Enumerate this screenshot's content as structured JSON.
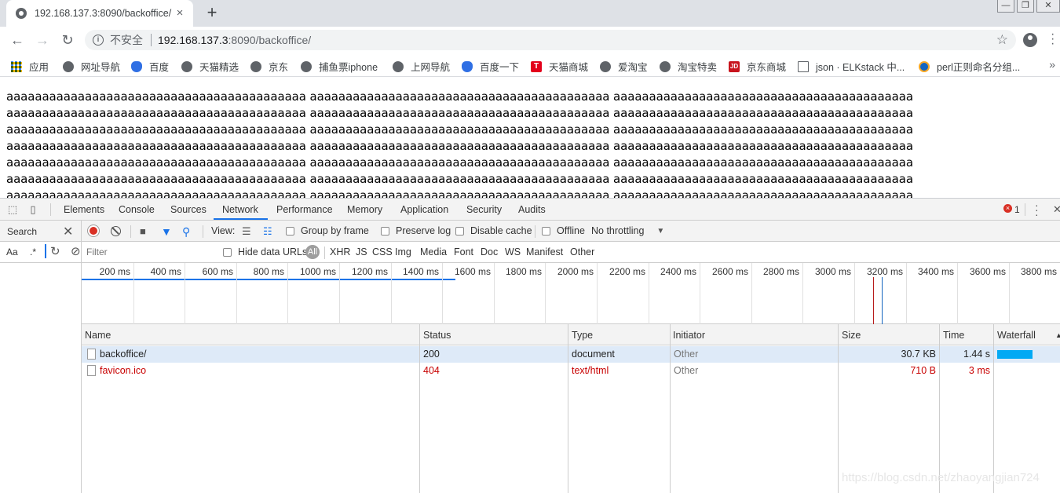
{
  "browser": {
    "tab_title": "192.168.137.3:8090/backoffice/",
    "tab_close": "×",
    "new_tab": "+",
    "window_controls": [
      "—",
      "❐",
      "✕"
    ],
    "security_label": "不安全",
    "url_host": "192.168.137.3",
    "url_rest": ":8090/backoffice/",
    "bookmarks": [
      {
        "label": "应用",
        "icon": "apps-grid-icon"
      },
      {
        "label": "网址导航",
        "icon": "globe-icon"
      },
      {
        "label": "百度",
        "icon": "baidu-paw-icon"
      },
      {
        "label": "天猫精选",
        "icon": "globe-icon"
      },
      {
        "label": "京东",
        "icon": "globe-icon"
      },
      {
        "label": "捕鱼票iphone",
        "icon": "globe-icon"
      },
      {
        "label": "上网导航",
        "icon": "globe-icon"
      },
      {
        "label": "百度一下",
        "icon": "baidu-paw-icon"
      },
      {
        "label": "天猫商城",
        "icon": "tmall-icon"
      },
      {
        "label": "爱淘宝",
        "icon": "globe-icon"
      },
      {
        "label": "淘宝特卖",
        "icon": "globe-icon"
      },
      {
        "label": "京东商城",
        "icon": "jd-icon"
      },
      {
        "label": "json · ELKstack 中...",
        "icon": "book-icon"
      },
      {
        "label": "perl正则命名分组...",
        "icon": "perl-icon"
      }
    ],
    "tmall_glyph": "T",
    "jd_glyph": "JD",
    "bookmarks_overflow": "»"
  },
  "page": {
    "lines": [
      "aaaaaaaaaaaaaaaaaaaaaaaaaaaaaaaaaaaaaaaaaa aaaaaaaaaaaaaaaaaaaaaaaaaaaaaaaaaaaaaaaaaa aaaaaaaaaaaaaaaaaaaaaaaaaaaaaaaaaaaaaaaaaa",
      "aaaaaaaaaaaaaaaaaaaaaaaaaaaaaaaaaaaaaaaaaa aaaaaaaaaaaaaaaaaaaaaaaaaaaaaaaaaaaaaaaaaa aaaaaaaaaaaaaaaaaaaaaaaaaaaaaaaaaaaaaaaaaa",
      "aaaaaaaaaaaaaaaaaaaaaaaaaaaaaaaaaaaaaaaaaa aaaaaaaaaaaaaaaaaaaaaaaaaaaaaaaaaaaaaaaaaa aaaaaaaaaaaaaaaaaaaaaaaaaaaaaaaaaaaaaaaaaa",
      "aaaaaaaaaaaaaaaaaaaaaaaaaaaaaaaaaaaaaaaaaa aaaaaaaaaaaaaaaaaaaaaaaaaaaaaaaaaaaaaaaaaa aaaaaaaaaaaaaaaaaaaaaaaaaaaaaaaaaaaaaaaaaa",
      "aaaaaaaaaaaaaaaaaaaaaaaaaaaaaaaaaaaaaaaaaa aaaaaaaaaaaaaaaaaaaaaaaaaaaaaaaaaaaaaaaaaa aaaaaaaaaaaaaaaaaaaaaaaaaaaaaaaaaaaaaaaaaa",
      "aaaaaaaaaaaaaaaaaaaaaaaaaaaaaaaaaaaaaaaaaa aaaaaaaaaaaaaaaaaaaaaaaaaaaaaaaaaaaaaaaaaa aaaaaaaaaaaaaaaaaaaaaaaaaaaaaaaaaaaaaaaaaa",
      "aaaaaaaaaaaaaaaaaaaaaaaaaaaaaaaaaaaaaaaaaa aaaaaaaaaaaaaaaaaaaaaaaaaaaaaaaaaaaaaaaaaa aaaaaaaaaaaaaaaaaaaaaaaaaaaaaaaaaaaaaaaaaa"
    ]
  },
  "devtools": {
    "tabs": [
      "Elements",
      "Console",
      "Sources",
      "Network",
      "Performance",
      "Memory",
      "Application",
      "Security",
      "Audits"
    ],
    "active_tab": "Network",
    "error_count": "1",
    "close": "✕",
    "search": {
      "label": "Search",
      "close": "✕",
      "match_case": "Aa",
      "regex": ".*"
    },
    "toolbar": {
      "view_label": "View:",
      "group_by_frame": "Group by frame",
      "preserve_log": "Preserve log",
      "disable_cache": "Disable cache",
      "offline": "Offline",
      "throttling": "No throttling"
    },
    "filter": {
      "placeholder": "Filter",
      "hide_data_urls": "Hide data URLs",
      "all": "All",
      "types": [
        "XHR",
        "JS",
        "CSS",
        "Img",
        "Media",
        "Font",
        "Doc",
        "WS",
        "Manifest",
        "Other"
      ]
    },
    "timeline_ticks": [
      "200 ms",
      "400 ms",
      "600 ms",
      "800 ms",
      "1000 ms",
      "1200 ms",
      "1400 ms",
      "1600 ms",
      "1800 ms",
      "2000 ms",
      "2200 ms",
      "2400 ms",
      "2600 ms",
      "2800 ms",
      "3000 ms",
      "3200 ms",
      "3400 ms",
      "3600 ms",
      "3800 ms"
    ],
    "columns": [
      "Name",
      "Status",
      "Type",
      "Initiator",
      "Size",
      "Time",
      "Waterfall"
    ],
    "requests": [
      {
        "name": "backoffice/",
        "status": "200",
        "type": "document",
        "initiator": "Other",
        "size": "30.7 KB",
        "time": "1.44 s",
        "error": false
      },
      {
        "name": "favicon.ico",
        "status": "404",
        "type": "text/html",
        "initiator": "Other",
        "size": "710 B",
        "time": "3 ms",
        "error": true
      }
    ],
    "colors": {
      "accent": "#1a73e8",
      "error": "#c80000",
      "waterfall": "#03a9f4",
      "record": "#d93025"
    }
  },
  "watermark": "https://blog.csdn.net/zhaoyangjian724"
}
